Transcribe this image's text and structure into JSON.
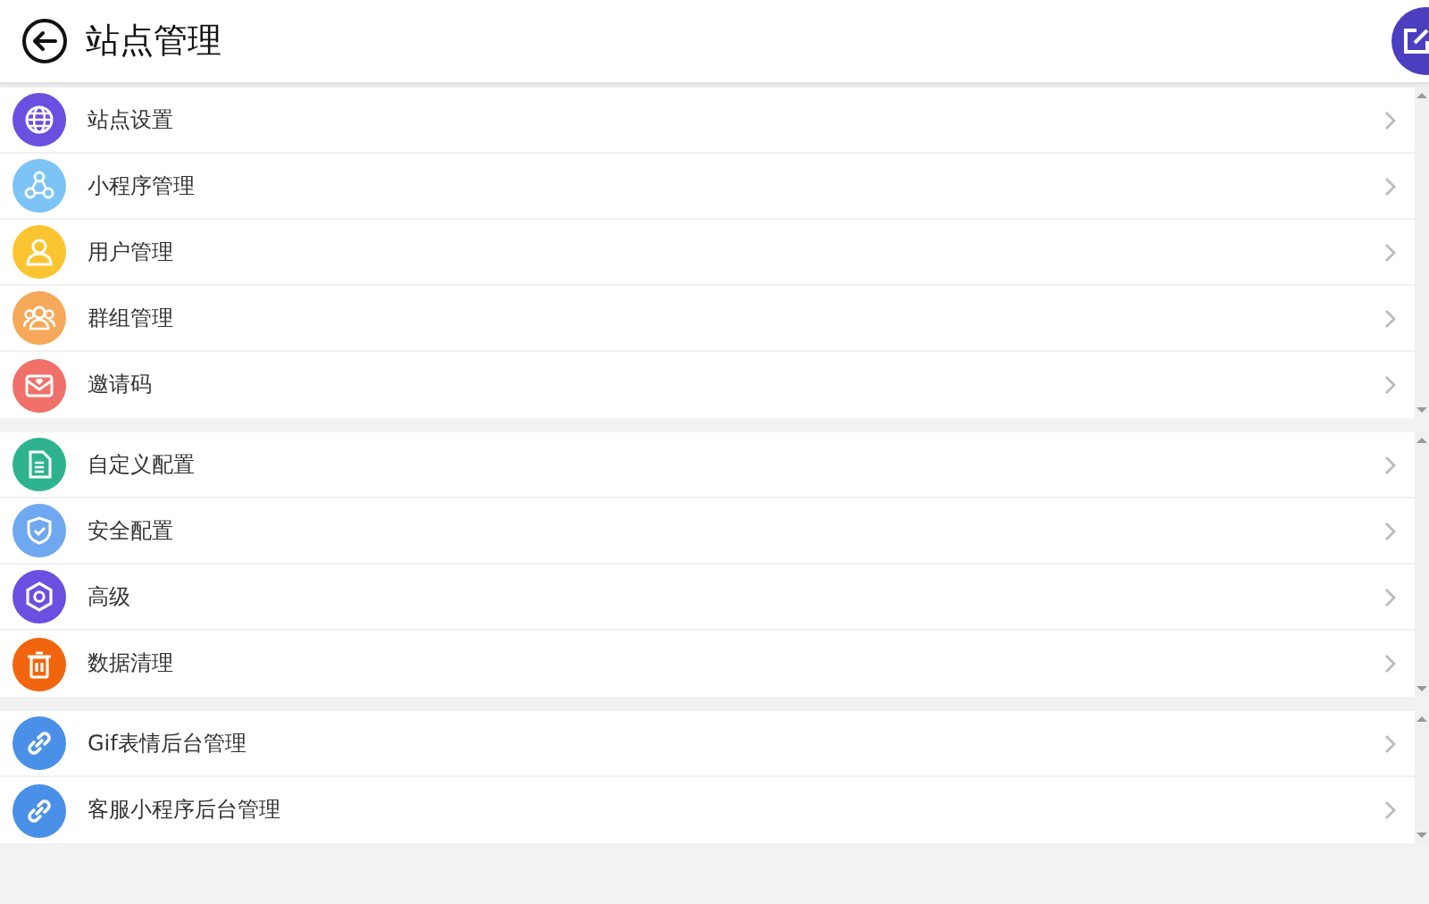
{
  "header": {
    "title": "站点管理"
  },
  "groups": [
    {
      "items": [
        {
          "label": "站点设置",
          "kind": "globe",
          "color": "#6a4fe0"
        },
        {
          "label": "小程序管理",
          "kind": "share",
          "color": "#7cc4f5"
        },
        {
          "label": "用户管理",
          "kind": "user",
          "color": "#fbc531"
        },
        {
          "label": "群组管理",
          "kind": "group",
          "color": "#f7a95a"
        },
        {
          "label": "邀请码",
          "kind": "mail",
          "color": "#f0706a"
        }
      ]
    },
    {
      "items": [
        {
          "label": "自定义配置",
          "kind": "doc",
          "color": "#2fb38f"
        },
        {
          "label": "安全配置",
          "kind": "shield",
          "color": "#6fa8f0"
        },
        {
          "label": "高级",
          "kind": "gear",
          "color": "#6a4fe0"
        },
        {
          "label": "数据清理",
          "kind": "trash",
          "color": "#f2650f"
        }
      ]
    },
    {
      "items": [
        {
          "label": "Gif表情后台管理",
          "kind": "link",
          "color": "#4a90e8"
        },
        {
          "label": "客服小程序后台管理",
          "kind": "link",
          "color": "#4a90e8"
        }
      ]
    }
  ]
}
